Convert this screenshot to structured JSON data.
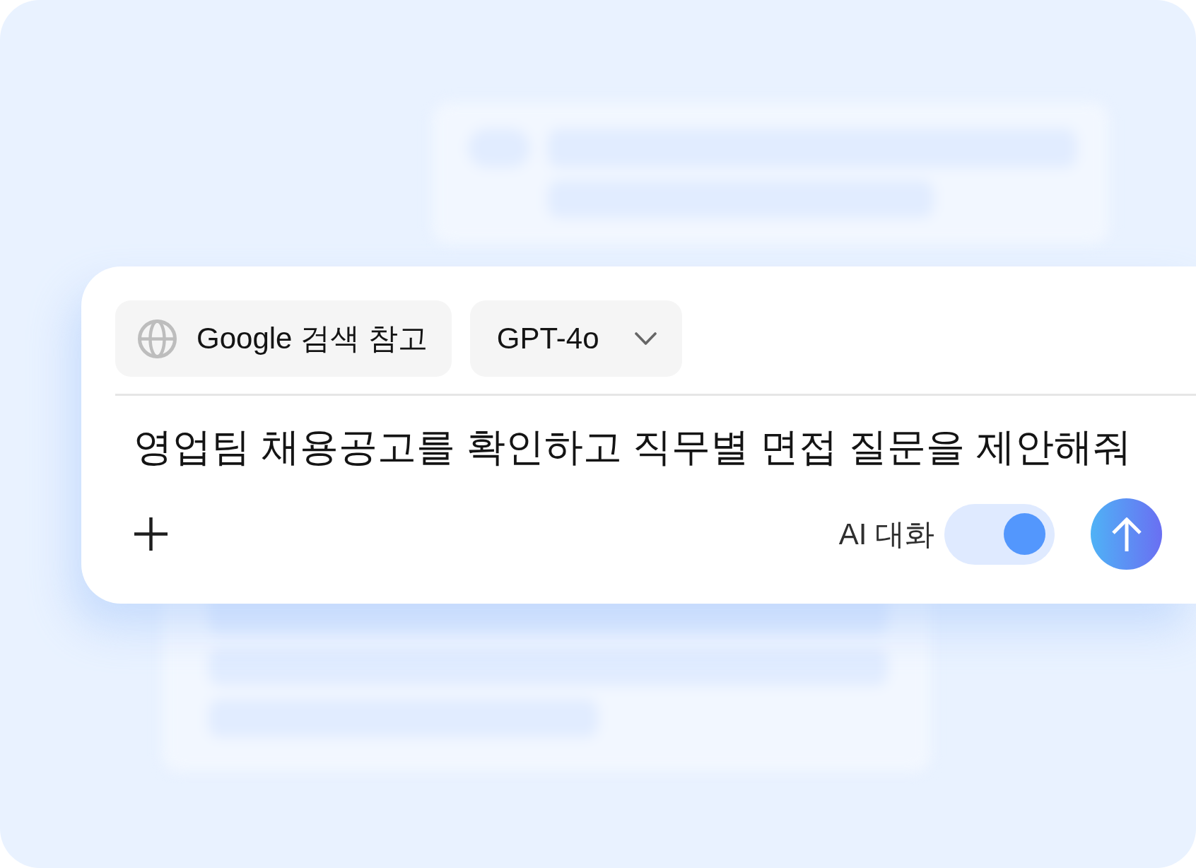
{
  "search_option": {
    "label": "Google 검색 참고"
  },
  "model_dropdown": {
    "value": "GPT-4o"
  },
  "prompt": {
    "value": "영업팀 채용공고를 확인하고 직무별 면접 질문을 제안해줘"
  },
  "ai_chat": {
    "label": "AI 대화",
    "on": true
  }
}
